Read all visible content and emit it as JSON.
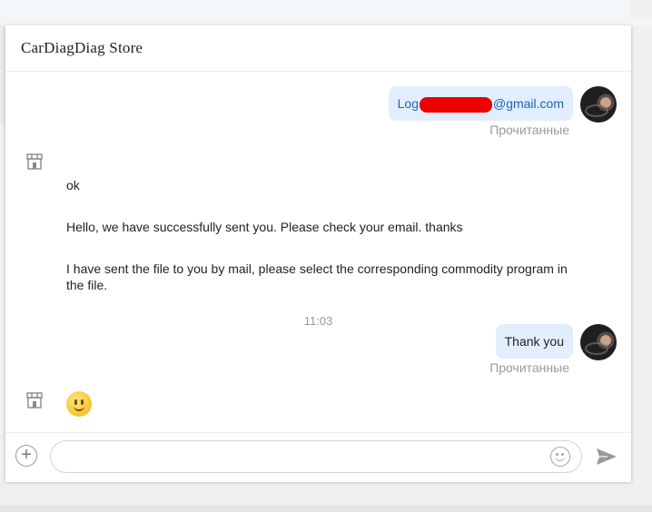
{
  "window": {
    "title": "CarDiagDiag Store"
  },
  "messages": {
    "email_prefix": "Log",
    "email_suffix": "@gmail.com",
    "read_status_1": "Прочитанные",
    "store_1": "ok",
    "store_2": "Hello, we have successfully sent you. Please check your email. thanks",
    "store_3": "I have sent the file to you by mail, please select the corresponding commodity program in the file.",
    "time": "11:03",
    "thanks": "Thank you",
    "read_status_2": "Прочитанные"
  },
  "composer": {
    "placeholder": ""
  },
  "icons": {
    "store": "store-icon",
    "avatar": "user-avatar",
    "add": "plus-icon",
    "emoji": "smiley-icon",
    "send": "send-icon"
  },
  "colors": {
    "bubble": "#e2eefd",
    "email": "#1a66b5",
    "redaction": "#ee0000"
  }
}
